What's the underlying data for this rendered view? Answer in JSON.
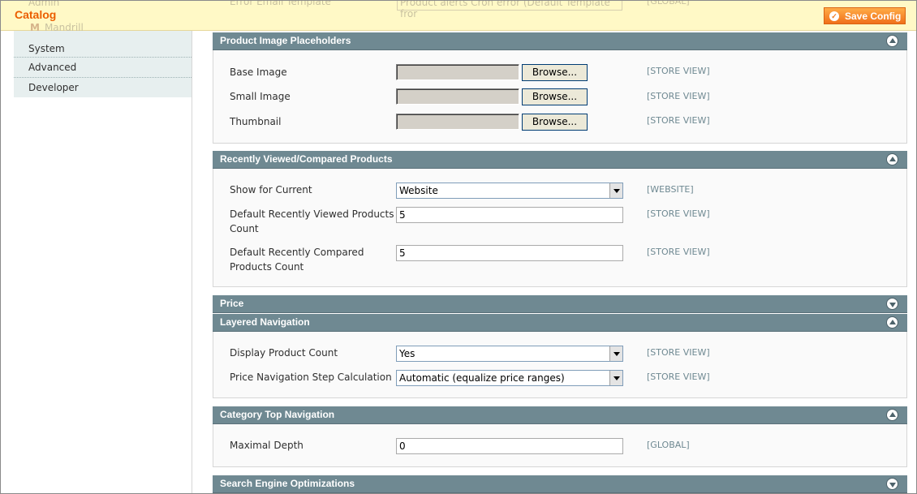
{
  "header": {
    "title": "Catalog",
    "save_label": "Save Config",
    "behind_admin": "Admin",
    "behind_mandrill": "Mandrill",
    "behind_field_label": "Error Email Template",
    "behind_field_value": "Product alerts Cron error (Default Template fror",
    "behind_field_scope": "[GLOBAL]"
  },
  "sidebar": {
    "items": [
      "System",
      "Advanced",
      "Developer"
    ]
  },
  "sections": {
    "placeholders": {
      "title": "Product Image Placeholders",
      "rows": [
        {
          "label": "Base Image",
          "button": "Browse...",
          "scope": "[STORE VIEW]"
        },
        {
          "label": "Small Image",
          "button": "Browse...",
          "scope": "[STORE VIEW]"
        },
        {
          "label": "Thumbnail",
          "button": "Browse...",
          "scope": "[STORE VIEW]"
        }
      ]
    },
    "recently": {
      "title": "Recently Viewed/Compared Products",
      "show_label": "Show for Current",
      "show_value": "Website",
      "show_scope": "[WEBSITE]",
      "viewed_label_1": "Default Recently Viewed Products",
      "viewed_label_2": "Count",
      "viewed_value": "5",
      "viewed_scope": "[STORE VIEW]",
      "compared_label_1": "Default Recently Compared",
      "compared_label_2": "Products Count",
      "compared_value": "5",
      "compared_scope": "[STORE VIEW]"
    },
    "price": {
      "title": "Price"
    },
    "layered": {
      "title": "Layered Navigation",
      "count_label": "Display Product Count",
      "count_value": "Yes",
      "count_scope": "[STORE VIEW]",
      "step_label": "Price Navigation Step Calculation",
      "step_value": "Automatic (equalize price ranges)",
      "step_scope": "[STORE VIEW]"
    },
    "category": {
      "title": "Category Top Navigation",
      "depth_label": "Maximal Depth",
      "depth_value": "0",
      "depth_scope": "[GLOBAL]"
    },
    "seo": {
      "title": "Search Engine Optimizations"
    }
  },
  "colors": {
    "accent": "#eb5e00",
    "section_header": "#6f8992",
    "scope_text": "#6f8992",
    "sticky_bg": "#fff9c6"
  },
  "icons": {
    "save": "check-circle-icon",
    "collapse": "chevron-up-circle-icon",
    "expand": "chevron-down-circle-icon"
  }
}
